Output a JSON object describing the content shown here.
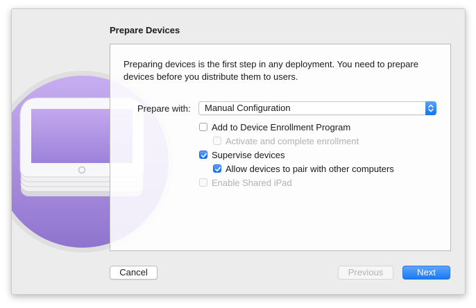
{
  "dialog": {
    "title": "Prepare Devices",
    "intro": "Preparing devices is the first step in any deployment. You need to prepare devices before you distribute them to users."
  },
  "prepare_with": {
    "label": "Prepare with:",
    "selected": "Manual Configuration"
  },
  "options": [
    {
      "label": "Add to Device Enrollment Program",
      "checked": false,
      "enabled": true
    },
    {
      "label": "Activate and complete enrollment",
      "checked": false,
      "enabled": false
    },
    {
      "label": "Supervise devices",
      "checked": true,
      "enabled": true
    },
    {
      "label": "Allow devices to pair with other computers",
      "checked": true,
      "enabled": true
    },
    {
      "label": "Enable Shared iPad",
      "checked": false,
      "enabled": false
    }
  ],
  "buttons": {
    "cancel": "Cancel",
    "previous": "Previous",
    "next": "Next"
  },
  "colors": {
    "accent": "#1474f0",
    "hero_purple": "#b497e6",
    "window_bg": "#ececec"
  },
  "icons": {
    "hero": "ipad-stack-icon",
    "popup": "up-down-chevron-icon",
    "check": "checkmark-icon"
  }
}
